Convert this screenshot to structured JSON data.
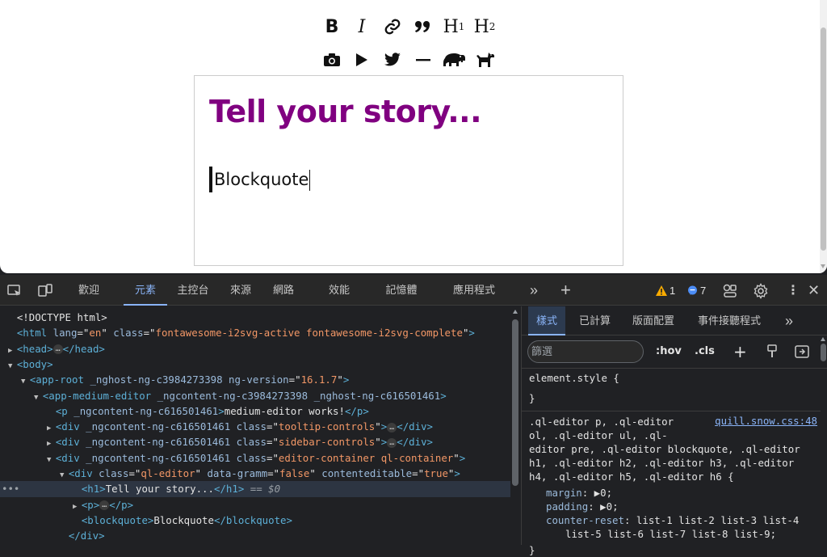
{
  "editor": {
    "toolbar_top": [
      {
        "name": "bold-button",
        "label": "B"
      },
      {
        "name": "italic-button",
        "label": "I"
      },
      {
        "name": "link-button",
        "icon": "link-icon"
      },
      {
        "name": "blockquote-button",
        "icon": "quote-icon"
      },
      {
        "name": "header1-button",
        "label": "H",
        "sub": "1"
      },
      {
        "name": "header2-button",
        "label": "H",
        "sub": "2"
      }
    ],
    "toolbar_bottom": [
      {
        "name": "image-button",
        "icon": "camera-icon"
      },
      {
        "name": "video-button",
        "icon": "play-icon"
      },
      {
        "name": "tweet-button",
        "icon": "twitter-icon"
      },
      {
        "name": "divider-button",
        "icon": "divider-icon"
      },
      {
        "name": "hippo-button",
        "icon": "hippo-icon"
      },
      {
        "name": "dog-button",
        "icon": "dog-icon"
      }
    ],
    "title": "Tell your story...",
    "blockquote": "Blockquote",
    "title_color": "#800080"
  },
  "devtools": {
    "tabs": [
      "歡迎",
      "元素",
      "主控台",
      "來源",
      "網路",
      "效能",
      "記憶體",
      "應用程式"
    ],
    "active_tab": "元素",
    "warnings_count": "1",
    "messages_count": "7",
    "dom_lines": [
      {
        "indent": 1,
        "html": "<!DOCTYPE html>"
      },
      {
        "indent": 1,
        "tag": "html",
        "attrs": [
          [
            "lang",
            "en"
          ],
          [
            "class",
            "fontawesome-i2svg-active fontawesome-i2svg-complete"
          ]
        ],
        "open": true
      },
      {
        "indent": 1,
        "tri": "right",
        "collapsed": "head"
      },
      {
        "indent": 1,
        "tri": "down",
        "tag": "body"
      },
      {
        "indent": 2,
        "tri": "down",
        "tag": "app-root",
        "attrs": [
          [
            "_nghost-ng-c3984273398",
            null
          ],
          [
            "ng-version",
            "16.1.7"
          ]
        ]
      },
      {
        "indent": 3,
        "tri": "down",
        "tag": "app-medium-editor",
        "attrs": [
          [
            "_ngcontent-ng-c3984273398",
            null
          ],
          [
            "_nghost-ng-c616501461",
            null
          ]
        ]
      },
      {
        "indent": 4,
        "tag": "p",
        "attrs": [
          [
            "_ngcontent-ng-c616501461",
            null
          ]
        ],
        "text": "medium-editor works!",
        "close": "p"
      },
      {
        "indent": 4,
        "tri": "right",
        "tag": "div",
        "attrs": [
          [
            "_ngcontent-ng-c616501461",
            null
          ],
          [
            "class",
            "tooltip-controls"
          ]
        ],
        "ell": true,
        "close": "div"
      },
      {
        "indent": 4,
        "tri": "right",
        "tag": "div",
        "attrs": [
          [
            "_ngcontent-ng-c616501461",
            null
          ],
          [
            "class",
            "sidebar-controls"
          ]
        ],
        "ell": true,
        "close": "div"
      },
      {
        "indent": 4,
        "tri": "down",
        "tag": "div",
        "attrs": [
          [
            "_ngcontent-ng-c616501461",
            null
          ],
          [
            "class",
            "editor-container ql-container"
          ]
        ]
      },
      {
        "indent": 5,
        "tri": "down",
        "tag": "div",
        "attrs": [
          [
            "class",
            "ql-editor"
          ],
          [
            "data-gramm",
            "false"
          ],
          [
            "contenteditable",
            "true"
          ]
        ]
      },
      {
        "indent": 6,
        "tag": "h1",
        "attrs": [],
        "text": "Tell your story...",
        "close": "h1",
        "selected": true,
        "suffix": " == $0"
      },
      {
        "indent": 6,
        "tri": "right",
        "tag": "p",
        "attrs": [],
        "ell": true,
        "close": "p"
      },
      {
        "indent": 6,
        "tag": "blockquote",
        "attrs": [],
        "text": "Blockquote",
        "close": "blockquote"
      },
      {
        "indent": 5,
        "closing": "div"
      }
    ],
    "styles_tabs": [
      "樣式",
      "已計算",
      "版面配置",
      "事件接聽程式"
    ],
    "filter_placeholder": "篩選",
    "hov": ":hov",
    "cls": ".cls",
    "element_style_open": "element.style {",
    "element_style_close": "}",
    "rule_selector_lines": [
      ".ql-editor p, .ql-editor",
      "ol, .ql-editor ul, .ql-",
      "editor pre, .ql-editor blockquote, .ql-editor",
      "h1, .ql-editor h2, .ql-editor h3, .ql-editor",
      "h4, .ql-editor h5, .ql-editor h6 {"
    ],
    "rule_source": "quill.snow.css:48",
    "rule_props": [
      {
        "prop": "margin",
        "val": "0",
        "tri": true
      },
      {
        "prop": "padding",
        "val": "0",
        "tri": true
      },
      {
        "prop": "counter-reset",
        "val": "list-1 list-2 list-3 list-4",
        "cont": "list-5 list-6 list-7 list-8 list-9;"
      }
    ],
    "rule_close": "}"
  }
}
